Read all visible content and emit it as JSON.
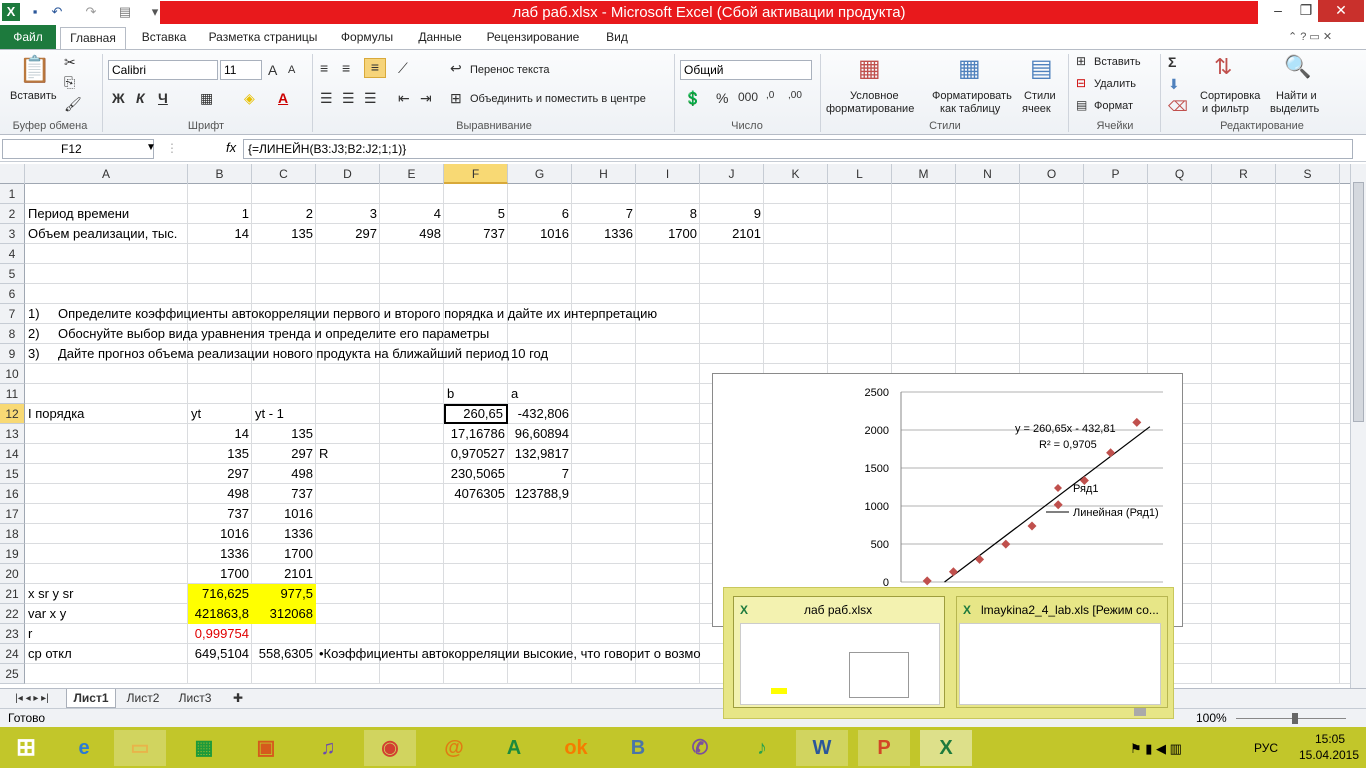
{
  "window": {
    "title": "лаб  раб.xlsx  -  Microsoft Excel (Сбой активации продукта)"
  },
  "tabs": {
    "file": "Файл",
    "home": "Главная",
    "insert": "Вставка",
    "page_layout": "Разметка страницы",
    "formulas": "Формулы",
    "data": "Данные",
    "review": "Рецензирование",
    "view": "Вид"
  },
  "ribbon": {
    "clipboard": {
      "paste": "Вставить",
      "group": "Буфер обмена"
    },
    "font": {
      "name": "Calibri",
      "size": "11",
      "group": "Шрифт",
      "bold": "Ж",
      "italic": "К",
      "underline": "Ч"
    },
    "alignment": {
      "wrap": "Перенос текста",
      "merge": "Объединить и поместить в центре",
      "group": "Выравнивание"
    },
    "number": {
      "format": "Общий",
      "group": "Число"
    },
    "styles": {
      "cond_line1": "Условное",
      "cond_line2": "форматирование",
      "table_line1": "Форматировать",
      "table_line2": "как таблицу",
      "cell_line1": "Стили",
      "cell_line2": "ячеек",
      "group": "Стили"
    },
    "cells": {
      "insert": "Вставить",
      "delete": "Удалить",
      "format": "Формат",
      "group": "Ячейки"
    },
    "editing": {
      "sort_line1": "Сортировка",
      "sort_line2": "и фильтр",
      "find_line1": "Найти и",
      "find_line2": "выделить",
      "group": "Редактирование"
    }
  },
  "formula_bar": {
    "name_box": "F12",
    "fx": "fx",
    "formula": "{=ЛИНЕЙН(B3:J3;B2:J2;1;1)}"
  },
  "columns": [
    "A",
    "B",
    "C",
    "D",
    "E",
    "F",
    "G",
    "H",
    "I",
    "J",
    "K",
    "L",
    "M",
    "N",
    "O",
    "P",
    "Q",
    "R",
    "S"
  ],
  "rows": [
    "1",
    "2",
    "3",
    "4",
    "5",
    "6",
    "7",
    "8",
    "9",
    "10",
    "11",
    "12",
    "13",
    "14",
    "15",
    "16",
    "17",
    "18",
    "19",
    "20",
    "21",
    "22",
    "23",
    "24",
    "25"
  ],
  "cells": {
    "A2": "Период времени",
    "B2": "1",
    "C2": "2",
    "D2": "3",
    "E2": "4",
    "F2": "5",
    "G2": "6",
    "H2": "7",
    "I2": "8",
    "J2": "9",
    "A3": "Объем реализации, тыс.",
    "B3": "14",
    "C3": "135",
    "D3": "297",
    "E3": "498",
    "F3": "737",
    "G3": "1016",
    "H3": "1336",
    "I3": "1700",
    "J3": "2101",
    "A7n": "1)",
    "A7": "Определите коэффициенты автокорреляции первого и второго порядка и дайте их интерпретацию",
    "A8n": "2)",
    "A8": "Обоснуйте выбор вида уравнения тренда и определите его параметры",
    "A9n": "3)",
    "A9": "Дайте прогноз объема реализации нового продукта на ближайший период",
    "G9": "10 год",
    "F11": "b",
    "G11": "a",
    "A12": "I порядка",
    "B12": "yt",
    "C12": "yt - 1",
    "F12": "260,65",
    "G12": "-432,806",
    "B13": "14",
    "C13": "135",
    "F13": "17,16786",
    "G13": "96,60894",
    "B14": "135",
    "C14": "297",
    "D14": "R",
    "F14": "0,970527",
    "G14": "132,9817",
    "B15": "297",
    "C15": "498",
    "F15": "230,5065",
    "G15": "7",
    "B16": "498",
    "C16": "737",
    "F16": "4076305",
    "G16": "123788,9",
    "B17": "737",
    "C17": "1016",
    "B18": "1016",
    "C18": "1336",
    "B19": "1336",
    "C19": "1700",
    "B20": "1700",
    "C20": "2101",
    "A21": "x sr      y sr",
    "B21": "716,625",
    "C21": "977,5",
    "A22": "var x      y",
    "B22": "421863,8",
    "C22": "312068",
    "A23": "r",
    "B23": "0,999754",
    "A24": "ср откл",
    "B24": "649,5104",
    "C24": "558,6305",
    "D24": "•Коэффициенты автокорреляции высокие, что говорит о возмо"
  },
  "chart_data": {
    "type": "scatter",
    "x": [
      1,
      2,
      3,
      4,
      5,
      6,
      7,
      8,
      9
    ],
    "series": [
      {
        "name": "Ряд1",
        "values": [
          14,
          135,
          297,
          498,
          737,
          1016,
          1336,
          1700,
          2101
        ]
      }
    ],
    "trendline": {
      "name": "Линейная (Ряд1)",
      "slope": 260.65,
      "intercept": -432.81
    },
    "equation": "y = 260,65x - 432,81",
    "r2": "R² = 0,9705",
    "ylim": [
      0,
      2500
    ],
    "yticks": [
      "2500",
      "2000",
      "1500",
      "1000",
      "500",
      "0"
    ],
    "legend_position": "right",
    "grid": true,
    "marker_color": "#c0504d"
  },
  "sheets": [
    "Лист1",
    "Лист2",
    "Лист3"
  ],
  "status": {
    "ready": "Готово",
    "zoom": "100%"
  },
  "taskbar_preview": {
    "win1": "лаб  раб.xlsx",
    "win2": "lmaykina2_4_lab.xls  [Режим со..."
  },
  "tray": {
    "lang": "РУС",
    "time": "15:05",
    "date": "15.04.2015"
  },
  "taskbar_icons": [
    "ie",
    "explorer",
    "store",
    "photo",
    "media",
    "chrome",
    "mail",
    "money",
    "ok",
    "vk",
    "viber",
    "music",
    "word",
    "powerpoint",
    "excel"
  ]
}
